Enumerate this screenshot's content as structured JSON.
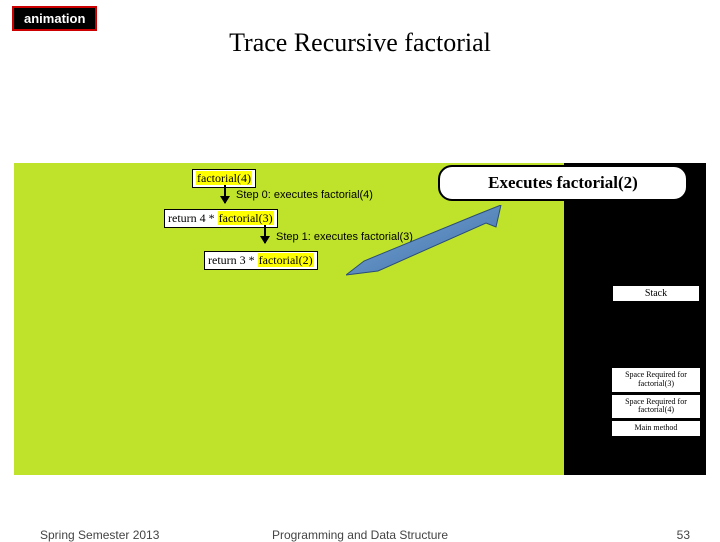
{
  "badge": "animation",
  "title": "Trace Recursive factorial",
  "callout": "Executes factorial(2)",
  "trace": {
    "call0": "factorial(4)",
    "step0": "Step 0: executes factorial(4)",
    "ret0_pre": "return 4 * ",
    "ret0_call": "factorial(3)",
    "step1": "Step 1: executes factorial(3)",
    "ret1_pre": "return 3 * ",
    "ret1_call": "factorial(2)"
  },
  "stack": {
    "label": "Stack",
    "frames": [
      "Space Required for factorial(3)",
      "Space Required for factorial(4)",
      "Main method"
    ]
  },
  "footer": {
    "left": "Spring Semester 2013",
    "center": "Programming and Data Structure",
    "right": "53"
  }
}
